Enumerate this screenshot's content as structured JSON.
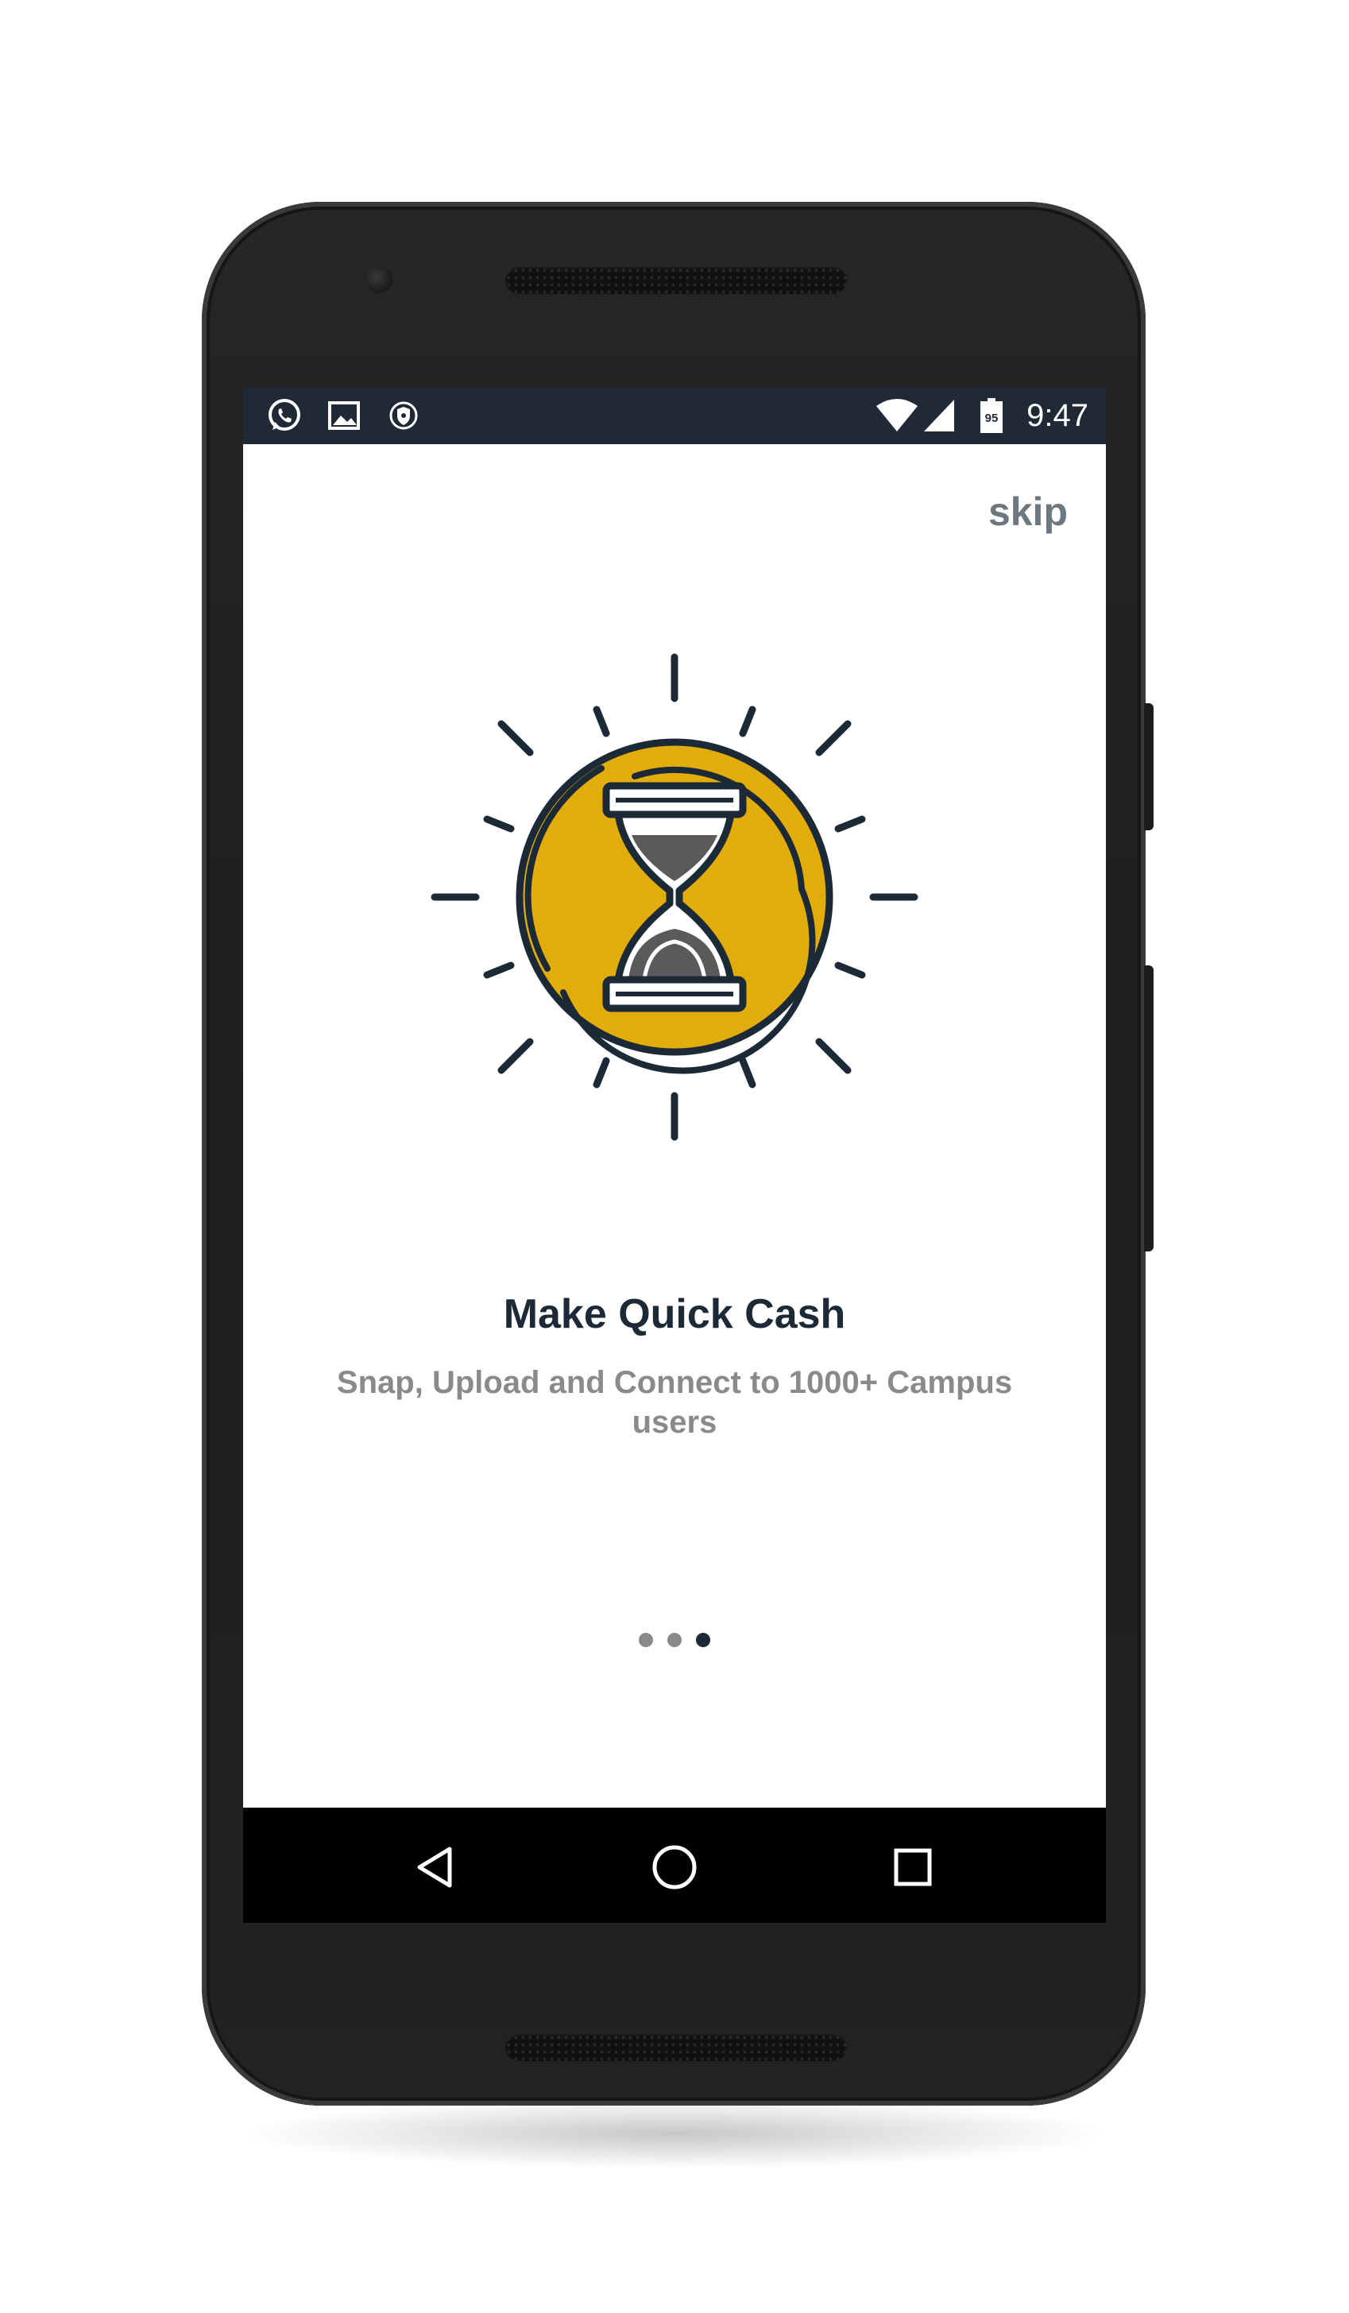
{
  "status_bar": {
    "time": "9:47",
    "battery_level_text": "95",
    "left_icons": [
      "whatsapp-icon",
      "gallery-icon",
      "shield-icon"
    ],
    "right_icons": [
      "wifi-icon",
      "cell-signal-icon",
      "battery-icon"
    ],
    "background": "#1f2a36"
  },
  "onboarding": {
    "skip_label": "skip",
    "title": "Make Quick Cash",
    "subtitle": "Snap, Upload and Connect to 1000+ Campus users",
    "illustration_icon": "hourglass-sun-icon",
    "accent_color": "#e2ac0b",
    "ink_color": "#1c2a38"
  },
  "pager": {
    "page_count": 3,
    "current_page": 3
  },
  "nav_bar": {
    "buttons": [
      "back-icon",
      "home-icon",
      "recents-icon"
    ]
  }
}
